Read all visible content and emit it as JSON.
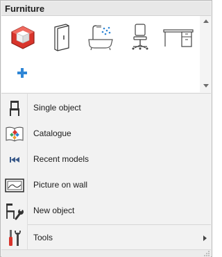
{
  "gallery": {
    "title": "Furniture",
    "tiles": [
      {
        "icon": "room-planner-logo-icon"
      },
      {
        "icon": "wardrobe-icon"
      },
      {
        "icon": "bathroom-shower-icon"
      },
      {
        "icon": "office-chair-icon"
      },
      {
        "icon": "desk-icon"
      },
      {
        "icon": "add-icon"
      }
    ]
  },
  "menu": {
    "items": [
      {
        "label": "Single object",
        "icon": "chair-icon"
      },
      {
        "label": "Catalogue",
        "icon": "catalogue-icon"
      },
      {
        "label": "Recent models",
        "icon": "rewind-icon"
      },
      {
        "label": "Picture on wall",
        "icon": "picture-frame-icon"
      },
      {
        "label": "New object",
        "icon": "new-object-wrench-icon"
      },
      {
        "label": "Tools",
        "icon": "tools-icon"
      }
    ]
  },
  "colors": {
    "accent_red": "#d9342b",
    "accent_blue": "#2f86d6",
    "icon_dark": "#333333"
  }
}
